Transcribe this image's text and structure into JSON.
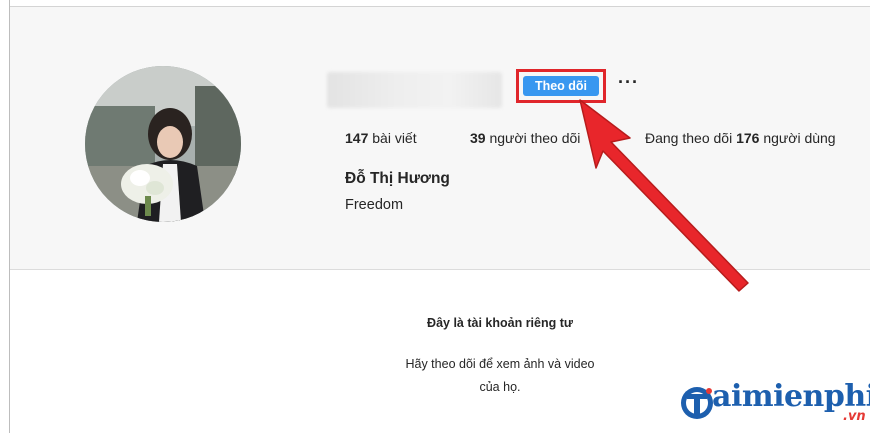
{
  "profile": {
    "follow_label": "Theo dõi",
    "more_label": "···",
    "posts": {
      "count": "147",
      "label": " bài viết"
    },
    "followers": {
      "count": "39",
      "label": " người theo dõi"
    },
    "following": {
      "prefix": "Đang theo dõi ",
      "count": "176",
      "suffix": " người dùng"
    },
    "full_name": "Đỗ Thị Hương",
    "bio": "Freedom"
  },
  "private_notice": {
    "title": "Đây là tài khoản riêng tư",
    "line1": "Hãy theo dõi để xem ảnh và video",
    "line2": "của họ."
  },
  "watermark": {
    "text": "aimienphi",
    "suffix": ".vn"
  },
  "colors": {
    "follow_button": "#3897f0",
    "highlight": "#e0262b",
    "text": "#262626",
    "profile_bg": "#f7f7f7",
    "watermark_blue": "#1d5fae",
    "watermark_red": "#e53935"
  },
  "icons": {
    "more": "more-horizontal-icon",
    "arrow": "annotation-arrow-icon",
    "logo": "taimienphi-logo-icon"
  }
}
